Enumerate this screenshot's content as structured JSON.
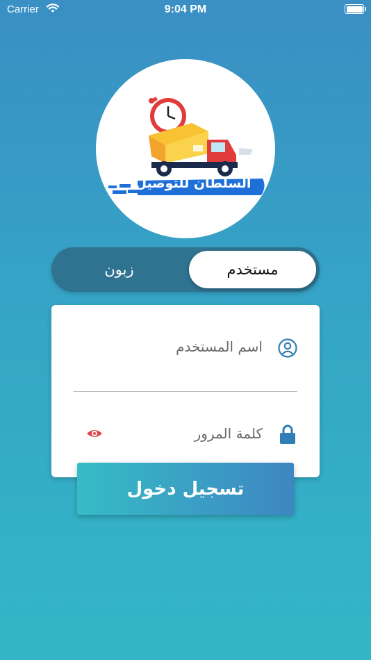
{
  "status_bar": {
    "carrier": "Carrier",
    "time": "9:04 PM"
  },
  "logo": {
    "text": "السلطان للتوصيل"
  },
  "role_toggle": {
    "options": [
      "مستخدم",
      "زبون"
    ],
    "selected": "مستخدم"
  },
  "form": {
    "username_placeholder": "اسم المستخدم",
    "password_placeholder": "كلمة المرور",
    "icons": {
      "username": "user-circle-icon",
      "password": "lock-icon",
      "reveal": "eye-icon"
    }
  },
  "login_button": {
    "label": "تسجيل دخول"
  },
  "colors": {
    "accent_start": "#36bcc6",
    "accent_end": "#3e86c2",
    "toggle_bg": "#2f7390",
    "eye": "#e0444a",
    "icon_blue": "#2f7fb6"
  }
}
